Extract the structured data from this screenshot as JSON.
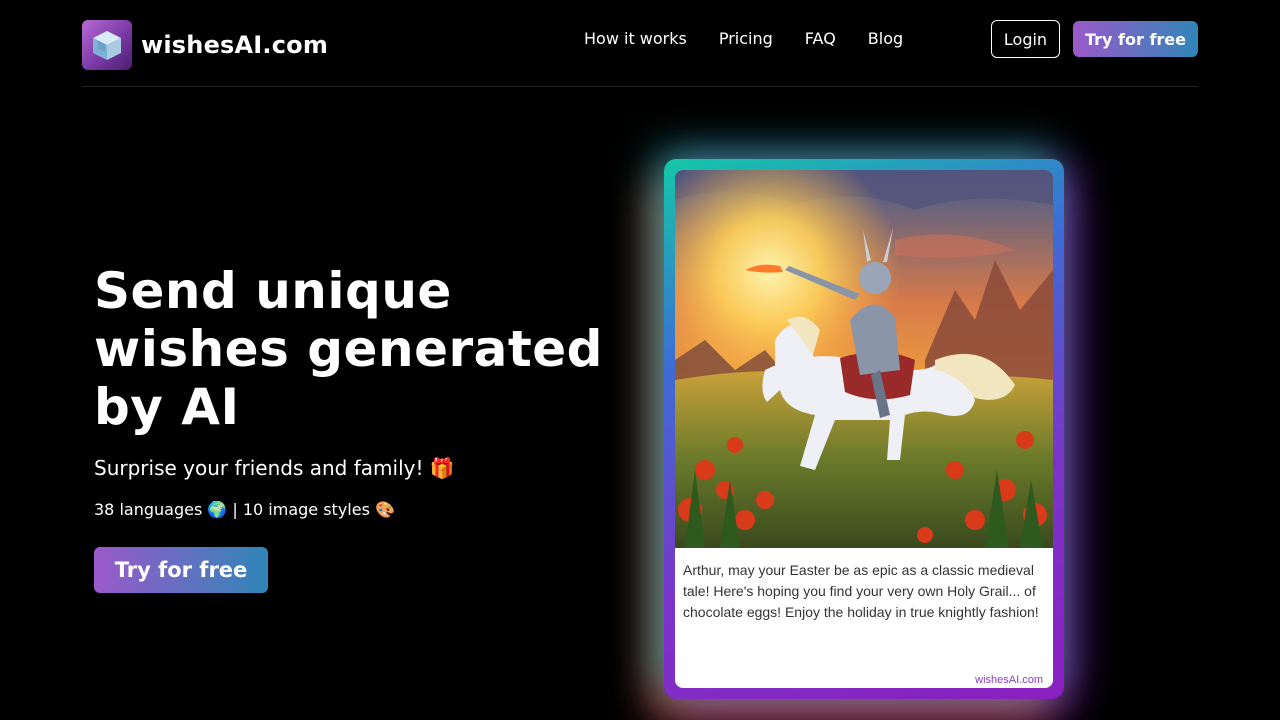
{
  "brand": {
    "name": "wishesAI.com",
    "logo_icon": "cube-icon"
  },
  "nav": {
    "items": [
      {
        "label": "How it works"
      },
      {
        "label": "Pricing"
      },
      {
        "label": "FAQ"
      },
      {
        "label": "Blog"
      }
    ]
  },
  "header": {
    "login_label": "Login",
    "try_label": "Try for free"
  },
  "hero": {
    "title": "Send unique wishes generated by AI",
    "subtitle": "Surprise your friends and family! 🎁",
    "meta": "38 languages 🌍 | 10 image styles 🎨",
    "cta_label": "Try for free"
  },
  "card": {
    "message": "Arthur, may your Easter be as epic as a classic medieval tale! Here's hoping you find your very own Holy Grail... of chocolate eggs! Enjoy the holiday in true knightly fashion!",
    "brand_mark": "wishesAI.com"
  },
  "colors": {
    "background": "#000000",
    "accent_gradient_start": "#9b59c9",
    "accent_gradient_end": "#2f86b8"
  }
}
